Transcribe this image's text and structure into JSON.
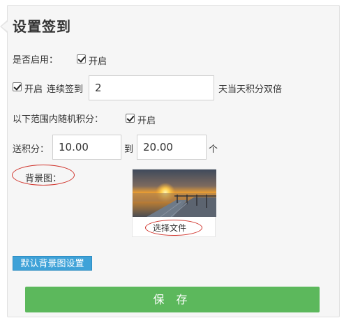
{
  "title": "设置签到",
  "enable": {
    "label": "是否启用：",
    "checkbox_label": "开启"
  },
  "streak": {
    "checkbox_label": "开启",
    "prefix": "连续签到",
    "value": "2",
    "suffix": "天当天积分双倍"
  },
  "random": {
    "label": "以下范围内随机积分：",
    "checkbox_label": "开启"
  },
  "points": {
    "label": "送积分：",
    "min": "10.00",
    "to": "到",
    "max": "20.00",
    "unit": "个"
  },
  "background": {
    "label": "背景图：",
    "choose_file": "选择文件"
  },
  "default_bg_button": "默认背景图设置",
  "save_button": "保 存",
  "colors": {
    "save": "#5cb85c",
    "default_button": "#3fa2d8",
    "annotation": "#d0342c"
  }
}
